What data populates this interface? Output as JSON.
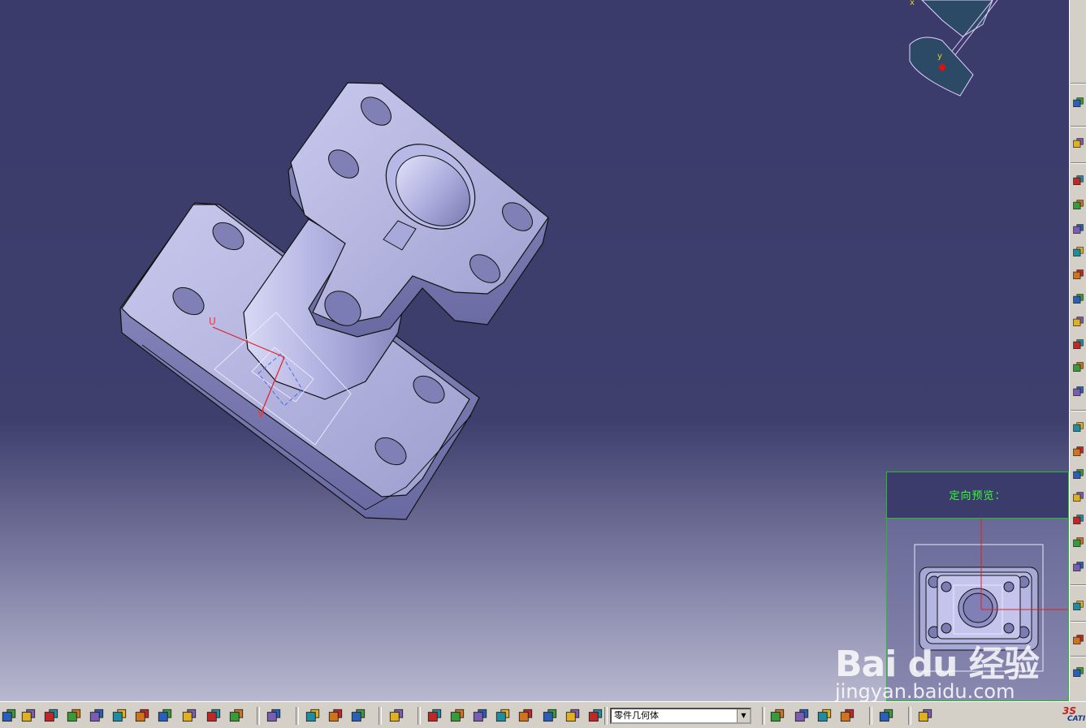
{
  "viewport": {
    "part_label_u": "U",
    "part_label_v": "V",
    "compass_label_x": "x",
    "compass_label_y": "y"
  },
  "preview": {
    "title": "定向预览：",
    "label_v": "V"
  },
  "right_toolbar": {
    "icons": [
      "select-icon",
      "sketch-icon",
      "pad-icon",
      "pocket-icon",
      "shaft-icon",
      "groove-icon",
      "hole-icon",
      "rib-icon",
      "slot-icon",
      "stiffener-icon",
      "loft-icon",
      "remove-loft-icon",
      "fillet-icon",
      "chamfer-icon",
      "draft-icon",
      "shell-icon",
      "thickness-icon",
      "thread-icon",
      "translate-icon",
      "mirror-icon",
      "pattern-icon",
      "boolean-icon",
      "reference-point-icon"
    ]
  },
  "bottom_toolbar": {
    "geometry_selector_value": "零件几何体",
    "icons": [
      "fit-all-icon",
      "pan-icon",
      "rotate-icon",
      "zoom-in-icon",
      "zoom-out-icon",
      "normal-view-icon",
      "multi-view-icon",
      "iso-view-icon",
      "shading-icon",
      "hide-show-icon",
      "swap-space-icon",
      "measure-between-icon",
      "measure-item-icon",
      "measure-inertia-icon",
      "capture-icon",
      "update-icon",
      "constraint-icon",
      "axis-system-icon",
      "table-icon",
      "create-body-icon",
      "boolean-body-icon",
      "parameters-icon",
      "scan-icon",
      "analysis-icon",
      "draft-analysis-icon",
      "curvature-icon",
      "thickness-analysis-icon",
      "apply-material-icon",
      "catalog-icon",
      "publication-icon"
    ]
  },
  "watermark": {
    "logo_text": "Bai du 经验",
    "url": "jingyan.baidu.com"
  },
  "brand": {
    "mark": "CATI"
  }
}
